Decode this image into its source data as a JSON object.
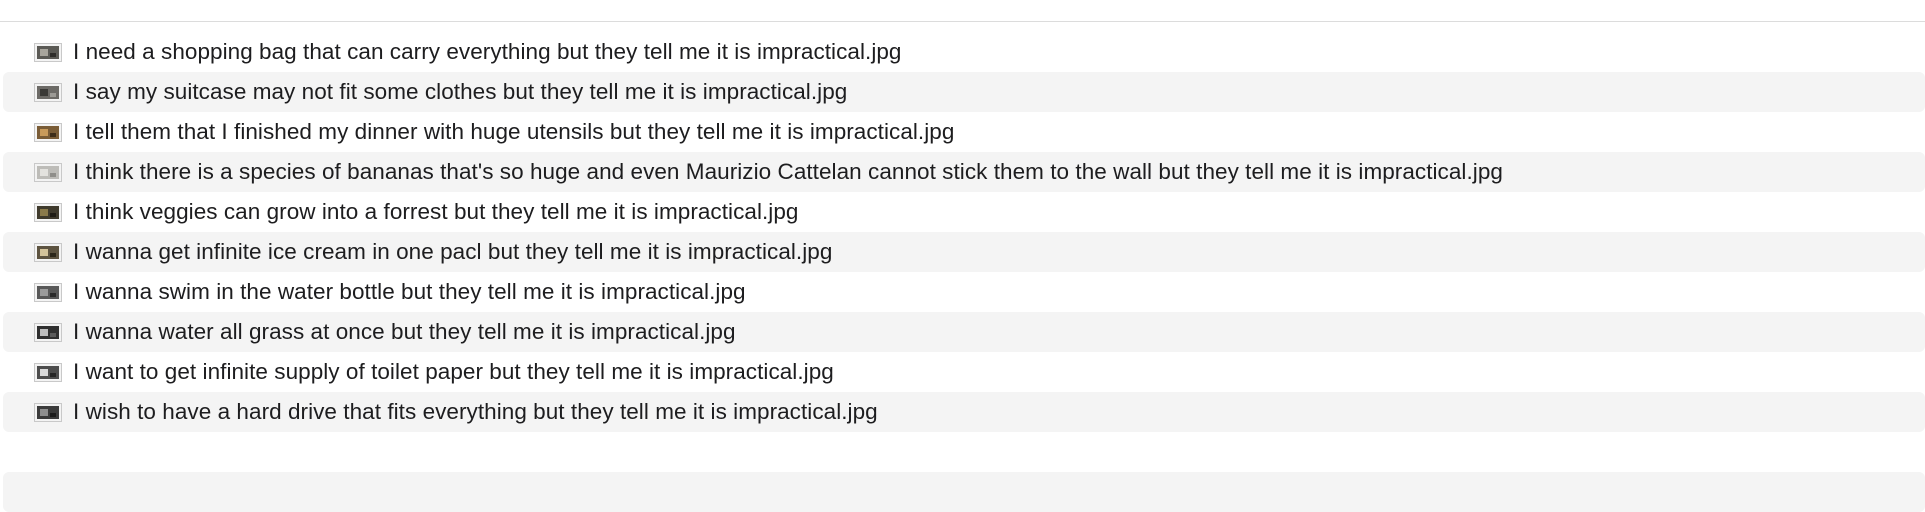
{
  "files": [
    {
      "name": "I need a shopping bag that can carry everything but they tell me it is impractical.jpg",
      "thumb": {
        "bg": "#5b5a55",
        "a": "#a8a59c",
        "b": "#2e2d2a"
      }
    },
    {
      "name": "I say my suitcase may not fit some clothes but they tell me it is impractical.jpg",
      "thumb": {
        "bg": "#6c6a66",
        "a": "#3a3936",
        "b": "#9c9a95"
      }
    },
    {
      "name": "I tell them that I finished my dinner with huge utensils but they tell me it is impractical.jpg",
      "thumb": {
        "bg": "#7a5c36",
        "a": "#c89a5a",
        "b": "#3d2c18"
      }
    },
    {
      "name": "I think there is a species of bananas that's so huge and even Maurizio Cattelan cannot stick them to the wall but they tell me it is impractical.jpg",
      "thumb": {
        "bg": "#bdbcb8",
        "a": "#e3e2de",
        "b": "#8f8e8a"
      }
    },
    {
      "name": "I think veggies can grow into a forrest but they tell me it is impractical.jpg",
      "thumb": {
        "bg": "#3f3a2c",
        "a": "#8a7a4a",
        "b": "#1f1c14"
      }
    },
    {
      "name": "I wanna get infinite ice cream in one pacl but they tell me it is impractical.jpg",
      "thumb": {
        "bg": "#5d5340",
        "a": "#d3c39a",
        "b": "#2c2619"
      }
    },
    {
      "name": "I wanna swim in the water bottle but they tell me it is impractical.jpg",
      "thumb": {
        "bg": "#585858",
        "a": "#9a9a9a",
        "b": "#2b2b2b"
      }
    },
    {
      "name": "I wanna water all grass at once but they tell me it is impractical.jpg",
      "thumb": {
        "bg": "#2f2f2f",
        "a": "#bdbdbd",
        "b": "#5a5a5a"
      }
    },
    {
      "name": "I want to get infinite supply of toilet paper but they tell me it is impractical.jpg",
      "thumb": {
        "bg": "#4d4d4d",
        "a": "#d9d9d9",
        "b": "#262626"
      }
    },
    {
      "name": "I wish to have a hard drive that fits everything but they tell me it is impractical.jpg",
      "thumb": {
        "bg": "#3b3b3b",
        "a": "#8f8f8f",
        "b": "#1c1c1c"
      }
    }
  ]
}
